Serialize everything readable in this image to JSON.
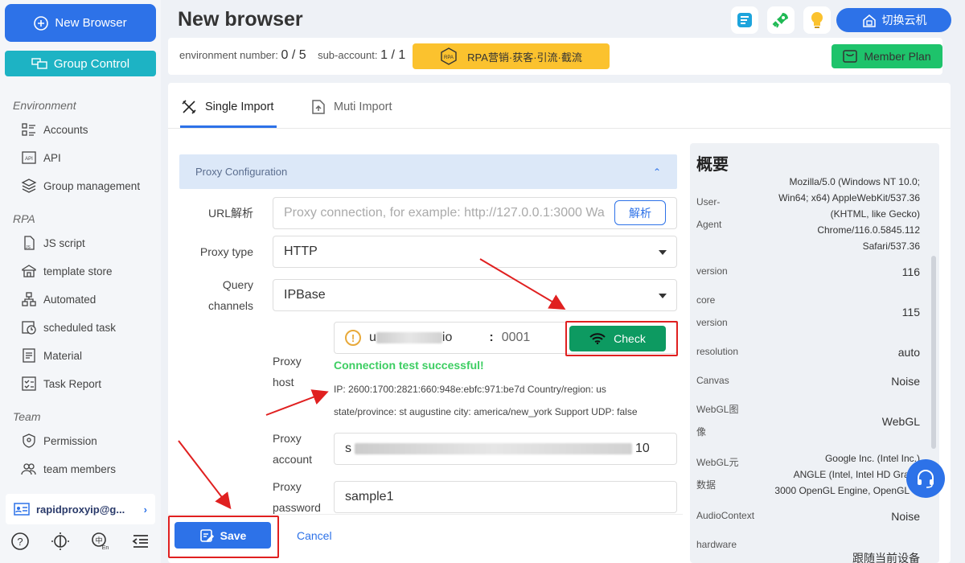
{
  "sidebar": {
    "new_browser": "New Browser",
    "group_control": "Group Control",
    "sections": {
      "environment": "Environment",
      "rpa": "RPA",
      "team": "Team"
    },
    "items": {
      "accounts": "Accounts",
      "api": "API",
      "group_management": "Group management",
      "js_script": "JS script",
      "template_store": "template store",
      "automated": "Automated",
      "scheduled_task": "scheduled task",
      "material": "Material",
      "task_report": "Task Report",
      "permission": "Permission",
      "team_members": "team members"
    },
    "account_email": "rapidproxyip@g..."
  },
  "header": {
    "title": "New browser",
    "switch_cloud": "切换云机"
  },
  "infobar": {
    "env_label": "environment number:",
    "env_value": "0 / 5",
    "sub_label": "sub-account:",
    "sub_value": "1 / 1",
    "rpa_banner": "RPA营销·获客·引流·截流",
    "member_plan": "Member Plan"
  },
  "tabs": {
    "single": "Single Import",
    "multi": "Muti Import"
  },
  "form": {
    "section_title": "Proxy Configuration",
    "url_label": "URL解析",
    "url_placeholder": "Proxy connection, for example: http://127.0.0.1:3000 Wa",
    "parse_button": "解析",
    "proxy_type_label": "Proxy type",
    "proxy_type_value": "HTTP",
    "query_label_1": "Query",
    "query_label_2": "channels",
    "query_value": "IPBase",
    "host_label_1": "Proxy",
    "host_label_2": "host",
    "host_prefix": "u",
    "host_mid": "io",
    "host_colon": ":",
    "host_port": "0001",
    "check_button": "Check",
    "success_text": "Connection test successful!",
    "ip_line_1": "IP: 2600:1700:2821:660:948e:ebfc:971:be7d Country/region: us",
    "ip_line_2": "state/province: st augustine city: america/new_york Support UDP: false",
    "account_label_1": "Proxy",
    "account_label_2": "account",
    "account_prefix": "s",
    "account_suffix": "10",
    "password_label_1": "Proxy",
    "password_label_2": "password",
    "password_value": "sample1",
    "save_button": "Save",
    "cancel_button": "Cancel"
  },
  "summary": {
    "title": "概要",
    "ua_label_1": "User-",
    "ua_label_2": "Agent",
    "ua_lines": [
      "Mozilla/5.0 (Windows NT 10.0;",
      "Win64; x64) AppleWebKit/537.36",
      "(KHTML, like Gecko)",
      "Chrome/116.0.5845.112",
      "Safari/537.36"
    ],
    "version_label": "version",
    "version_value": "116",
    "core_label_1": "core",
    "core_label_2": "version",
    "core_value": "115",
    "resolution_label": "resolution",
    "resolution_value": "auto",
    "canvas_label": "Canvas",
    "canvas_value": "Noise",
    "webgl_img_label_1": "WebGL图",
    "webgl_img_label_2": "像",
    "webgl_img_value": "WebGL",
    "webgl_meta_label_1": "WebGL元",
    "webgl_meta_label_2": "数据",
    "webgl_meta_lines": [
      "Google Inc. (Intel Inc.)",
      "ANGLE (Intel, Intel HD Graph",
      "3000 OpenGL Engine, OpenGL 4."
    ],
    "audio_label": "AudioContext",
    "audio_value": "Noise",
    "hardware_label": "hardware",
    "hardware_value": "跟随当前设备"
  },
  "colors": {
    "primary": "#2d72e8",
    "group_control": "#1db3c4",
    "check_green": "#0d9a61",
    "member_green": "#1ec36b",
    "success_text": "#3dce62",
    "rpa_yellow": "#fbc22e",
    "annotation_red": "#e02020"
  }
}
